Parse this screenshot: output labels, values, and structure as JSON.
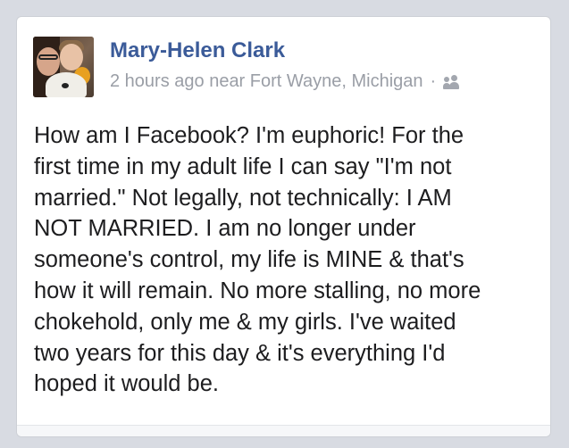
{
  "post": {
    "author": "Mary-Helen Clark",
    "time": "2 hours ago near Fort Wayne, Michigan",
    "separator": "·",
    "privacy_icon": "friends-icon",
    "text": "How am I Facebook? I'm euphoric! For the\nfirst time in my adult life I can say \"I'm not\nmarried.\" Not legally, not technically: I AM\nNOT MARRIED. I am no longer under\nsomeone's control, my life is MINE & that's\nhow it will remain. No more stalling, no more\nchokehold, only me & my girls. I've waited\ntwo years for this day & it's everything I'd\nhoped it would be."
  },
  "colors": {
    "author": "#3b5b99",
    "meta": "#9a9ea6",
    "text": "#1d1d1f",
    "background": "#d8dbe2"
  }
}
